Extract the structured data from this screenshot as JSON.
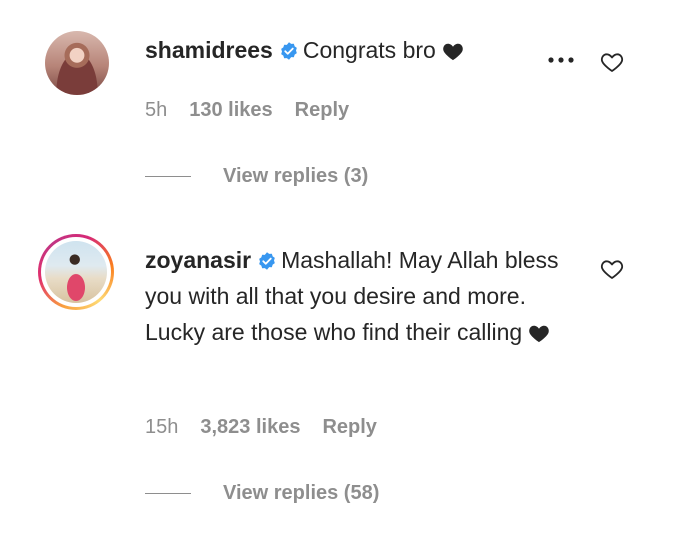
{
  "comments": [
    {
      "username": "shamidrees",
      "text": "Congrats bro",
      "time": "5h",
      "likes": "130 likes",
      "reply_label": "Reply",
      "view_replies": "View replies (3)"
    },
    {
      "username": "zoyanasir",
      "text": "Mashallah! May Allah bless you with all that you desire and more. Lucky are those who find their calling",
      "time": "15h",
      "likes": "3,823 likes",
      "reply_label": "Reply",
      "view_replies": "View replies (58)"
    }
  ],
  "icons": {
    "verified": "verified-badge-icon",
    "heart": "black-heart-icon",
    "like": "heart-outline-icon",
    "more": "more-options-icon"
  },
  "colors": {
    "text": "#262626",
    "muted": "#8e8e8e",
    "verified": "#3897f0"
  }
}
